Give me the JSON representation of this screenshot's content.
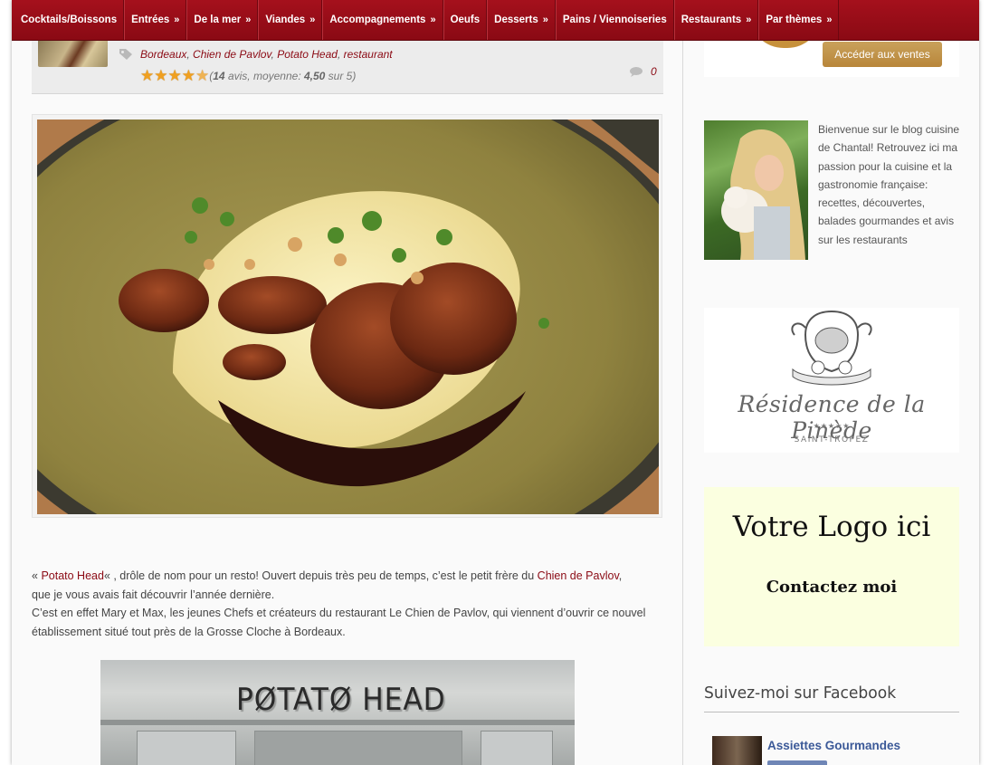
{
  "nav": {
    "items": [
      {
        "label": "Cocktails/Boissons",
        "arrow": ""
      },
      {
        "label": "Entrées",
        "arrow": "»"
      },
      {
        "label": "De la mer",
        "arrow": "»"
      },
      {
        "label": "Viandes",
        "arrow": "»"
      },
      {
        "label": "Accompagnements",
        "arrow": "»"
      },
      {
        "label": "Oeufs",
        "arrow": ""
      },
      {
        "label": "Desserts",
        "arrow": "»"
      },
      {
        "label": "Pains / Viennoiseries",
        "arrow": ""
      },
      {
        "label": "Restaurants",
        "arrow": "»"
      },
      {
        "label": "Par thèmes",
        "arrow": "»"
      }
    ]
  },
  "post": {
    "tags": [
      "Bordeaux",
      "Chien de Pavlov",
      "Potato Head",
      "restaurant"
    ],
    "tag_sep": ", ",
    "rating": {
      "stars": 4.5,
      "star_glyph": "★",
      "open": "(",
      "count": "14",
      "avis": " avis, moyenne: ",
      "average": "4,50",
      "sur": " sur 5)"
    },
    "comments": "0"
  },
  "article": {
    "p1_open": "« ",
    "p1_link1": "Potato Head",
    "p1_mid": "« , drôle de nom pour un resto! Ouvert depuis très peu de temps, c’est le petit frère du ",
    "p1_link2": "Chien de Pavlov",
    "p1_end": ",",
    "p1_line2": "que je vous avais fait découvrir l’année dernière.",
    "p2": "C’est en effet Mary et Max, les jeunes Chefs et créateurs du restaurant Le Chien de Pavlov, qui viennent d’ouvrir ce nouvel établissement situé tout près de la Grosse Cloche à Bordeaux.",
    "shop_sign": "PØTATØ HEAD"
  },
  "sidebar": {
    "promo_button": "Accéder aux ventes",
    "about": "Bienvenue sur le blog cuisine de Chantal! Retrouvez ici ma passion pour la cuisine et la gastronomie française: recettes, découvertes, balades gourmandes et avis sur les restaurants",
    "residence_name": "Résidence de la Pinède",
    "residence_stars": "★★★★★",
    "residence_city": "SAINT-TROPEZ",
    "ad_title": "Votre Logo ici",
    "ad_sub": "Contactez moi",
    "fb_title": "Suivez-moi sur Facebook",
    "fb_page": "Assiettes Gourmandes"
  },
  "colors": {
    "nav": "#a5101c",
    "link": "#8b0a14",
    "star": "#f0a020",
    "ad_bg": "#fbffe0",
    "facebook": "#3b5998",
    "promo_button": "#c9a15b"
  }
}
